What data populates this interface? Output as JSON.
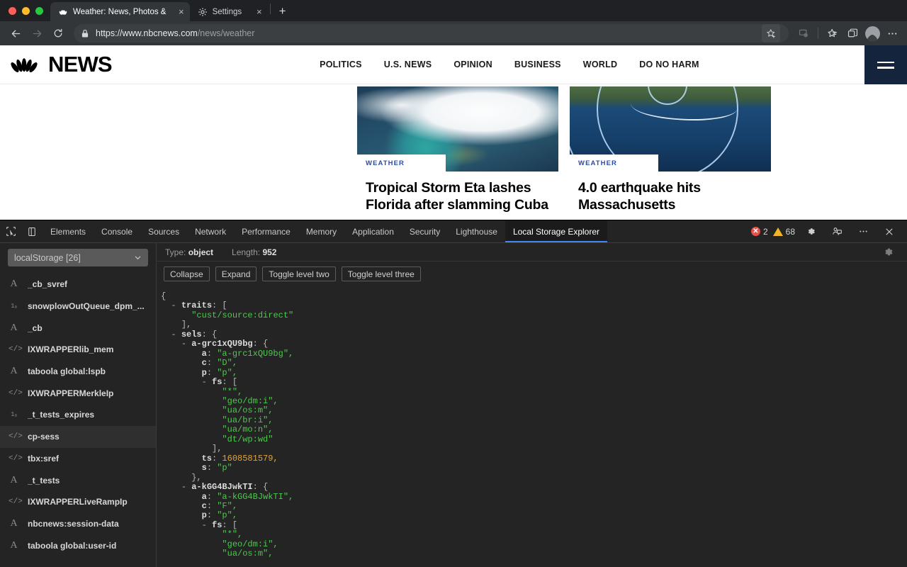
{
  "browser": {
    "tabs": [
      {
        "title": "Weather: News, Photos &amp",
        "favicon": "peacock-icon",
        "active": true,
        "close_label": "×"
      },
      {
        "title": "Settings",
        "favicon": "gear-icon",
        "active": false,
        "close_label": "×"
      }
    ],
    "new_tab_label": "+",
    "url_display": "https://www.nbcnews.com",
    "url_path": "/news/weather",
    "toolbar_icons": [
      "back-icon",
      "forward-icon",
      "reload-icon",
      "lock-icon",
      "favorite-icon",
      "collections-icon",
      "favorites-bar-icon",
      "browser-essentials-icon",
      "profile-icon",
      "settings-more-icon"
    ]
  },
  "page": {
    "brand": "NEWS",
    "nav": [
      {
        "label": "POLITICS"
      },
      {
        "label": "U.S. NEWS"
      },
      {
        "label": "OPINION"
      },
      {
        "label": "BUSINESS"
      },
      {
        "label": "WORLD"
      },
      {
        "label": "DO NO HARM"
      }
    ],
    "cards": [
      {
        "eyebrow": "WEATHER",
        "title": "Tropical Storm Eta lashes Florida after slamming Cuba"
      },
      {
        "eyebrow": "WEATHER",
        "title": "4.0 earthquake hits Massachusetts"
      }
    ],
    "accent_eyebrow_color": "#2a4ca8",
    "menu_bg_color": "#15243d"
  },
  "devtools": {
    "tabs": [
      {
        "label": "Elements",
        "active": false
      },
      {
        "label": "Console",
        "active": false
      },
      {
        "label": "Sources",
        "active": false
      },
      {
        "label": "Network",
        "active": false
      },
      {
        "label": "Performance",
        "active": false
      },
      {
        "label": "Memory",
        "active": false
      },
      {
        "label": "Application",
        "active": false
      },
      {
        "label": "Security",
        "active": false
      },
      {
        "label": "Lighthouse",
        "active": false
      },
      {
        "label": "Local Storage Explorer",
        "active": true
      }
    ],
    "error_count": "2",
    "warning_count": "68",
    "active_tab_underline_color": "#4285f4"
  },
  "storage_explorer": {
    "scope_select": "localStorage [26]",
    "keys": [
      {
        "name": "_cb_svref",
        "type": "string",
        "icon": "A",
        "selected": false
      },
      {
        "name": "snowplowOutQueue_dpm_...",
        "type": "number",
        "icon": "1₀",
        "selected": false
      },
      {
        "name": "_cb",
        "type": "string",
        "icon": "A",
        "selected": false
      },
      {
        "name": "IXWRAPPERlib_mem",
        "type": "object",
        "icon": "</>",
        "selected": false
      },
      {
        "name": "taboola global:lspb",
        "type": "string",
        "icon": "A",
        "selected": false
      },
      {
        "name": "IXWRAPPERMerkleIp",
        "type": "object",
        "icon": "</>",
        "selected": false
      },
      {
        "name": "_t_tests_expires",
        "type": "number",
        "icon": "1₀",
        "selected": false
      },
      {
        "name": "cp-sess",
        "type": "object",
        "icon": "</>",
        "selected": true
      },
      {
        "name": "tbx:sref",
        "type": "object",
        "icon": "</>",
        "selected": false
      },
      {
        "name": "_t_tests",
        "type": "string",
        "icon": "A",
        "selected": false
      },
      {
        "name": "IXWRAPPERLiveRampIp",
        "type": "object",
        "icon": "</>",
        "selected": false
      },
      {
        "name": "nbcnews:session-data",
        "type": "string",
        "icon": "A",
        "selected": false
      },
      {
        "name": "taboola global:user-id",
        "type": "string",
        "icon": "A",
        "selected": false
      }
    ],
    "meta": {
      "type_label": "Type:",
      "type_value": "object",
      "length_label": "Length:",
      "length_value": "952"
    },
    "buttons": [
      {
        "label": "Collapse"
      },
      {
        "label": "Expand"
      },
      {
        "label": "Toggle level two"
      },
      {
        "label": "Toggle level three"
      }
    ],
    "json_lines": [
      {
        "indent": 0,
        "toggle": "",
        "key": "",
        "punct": "{",
        "value": "",
        "vtype": ""
      },
      {
        "indent": 1,
        "toggle": "-",
        "key": "traits",
        "punct": ": [",
        "value": "",
        "vtype": ""
      },
      {
        "indent": 3,
        "toggle": "",
        "key": "",
        "punct": "",
        "value": "\"cust/source:direct\"",
        "vtype": "s"
      },
      {
        "indent": 2,
        "toggle": "",
        "key": "",
        "punct": "],",
        "value": "",
        "vtype": ""
      },
      {
        "indent": 1,
        "toggle": "-",
        "key": "sels",
        "punct": ": {",
        "value": "",
        "vtype": ""
      },
      {
        "indent": 2,
        "toggle": "-",
        "key": "a-grc1xQU9bg",
        "punct": ": {",
        "value": "",
        "vtype": ""
      },
      {
        "indent": 4,
        "toggle": "",
        "key": "a",
        "punct": ": ",
        "value": "\"a-grc1xQU9bg\",",
        "vtype": "s"
      },
      {
        "indent": 4,
        "toggle": "",
        "key": "c",
        "punct": ": ",
        "value": "\"D\",",
        "vtype": "s"
      },
      {
        "indent": 4,
        "toggle": "",
        "key": "p",
        "punct": ": ",
        "value": "\"p\",",
        "vtype": "s"
      },
      {
        "indent": 4,
        "toggle": "-",
        "key": "fs",
        "punct": ": [",
        "value": "",
        "vtype": ""
      },
      {
        "indent": 6,
        "toggle": "",
        "key": "",
        "punct": "",
        "value": "\"*\",",
        "vtype": "s"
      },
      {
        "indent": 6,
        "toggle": "",
        "key": "",
        "punct": "",
        "value": "\"geo/dm:i\",",
        "vtype": "s"
      },
      {
        "indent": 6,
        "toggle": "",
        "key": "",
        "punct": "",
        "value": "\"ua/os:m\",",
        "vtype": "s"
      },
      {
        "indent": 6,
        "toggle": "",
        "key": "",
        "punct": "",
        "value": "\"ua/br:i\",",
        "vtype": "s"
      },
      {
        "indent": 6,
        "toggle": "",
        "key": "",
        "punct": "",
        "value": "\"ua/mo:n\",",
        "vtype": "s"
      },
      {
        "indent": 6,
        "toggle": "",
        "key": "",
        "punct": "",
        "value": "\"dt/wp:wd\"",
        "vtype": "s"
      },
      {
        "indent": 5,
        "toggle": "",
        "key": "",
        "punct": "],",
        "value": "",
        "vtype": ""
      },
      {
        "indent": 4,
        "toggle": "",
        "key": "ts",
        "punct": ": ",
        "value": "1608581579,",
        "vtype": "n"
      },
      {
        "indent": 4,
        "toggle": "",
        "key": "s",
        "punct": ": ",
        "value": "\"p\"",
        "vtype": "s"
      },
      {
        "indent": 3,
        "toggle": "",
        "key": "",
        "punct": "},",
        "value": "",
        "vtype": ""
      },
      {
        "indent": 2,
        "toggle": "-",
        "key": "a-kGG4BJwkTI",
        "punct": ": {",
        "value": "",
        "vtype": ""
      },
      {
        "indent": 4,
        "toggle": "",
        "key": "a",
        "punct": ": ",
        "value": "\"a-kGG4BJwkTI\",",
        "vtype": "s"
      },
      {
        "indent": 4,
        "toggle": "",
        "key": "c",
        "punct": ": ",
        "value": "\"F\",",
        "vtype": "s"
      },
      {
        "indent": 4,
        "toggle": "",
        "key": "p",
        "punct": ": ",
        "value": "\"p\",",
        "vtype": "s"
      },
      {
        "indent": 4,
        "toggle": "-",
        "key": "fs",
        "punct": ": [",
        "value": "",
        "vtype": ""
      },
      {
        "indent": 6,
        "toggle": "",
        "key": "",
        "punct": "",
        "value": "\"*\",",
        "vtype": "s"
      },
      {
        "indent": 6,
        "toggle": "",
        "key": "",
        "punct": "",
        "value": "\"geo/dm:i\",",
        "vtype": "s"
      },
      {
        "indent": 6,
        "toggle": "",
        "key": "",
        "punct": "",
        "value": "\"ua/os:m\",",
        "vtype": "s"
      }
    ]
  }
}
